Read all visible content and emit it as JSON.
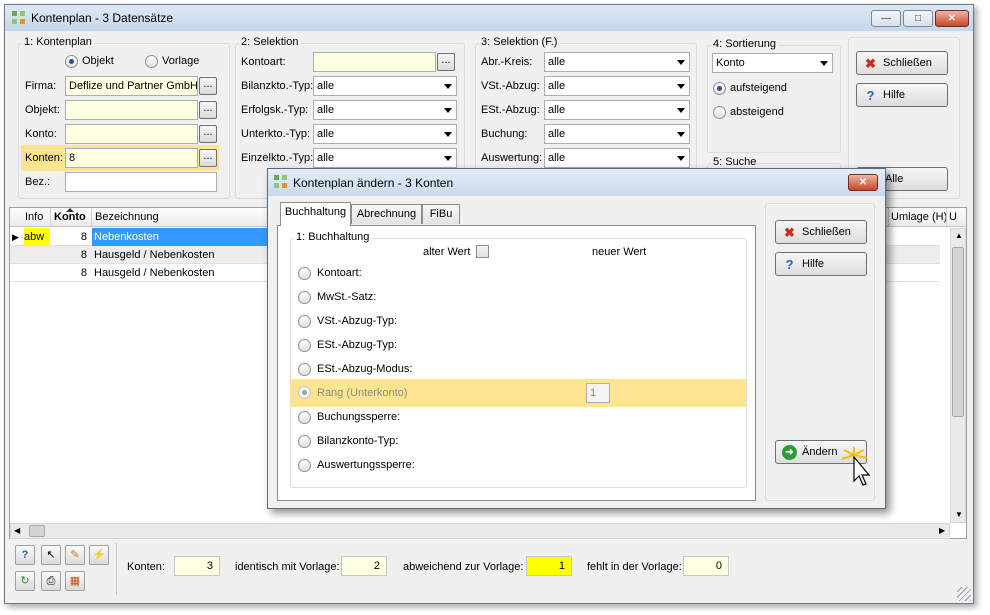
{
  "window": {
    "title": "Kontenplan - 3 Datensätze"
  },
  "group_kontenplan": {
    "label": "1: Kontenplan",
    "radio_objekt": "Objekt",
    "radio_vorlage": "Vorlage",
    "firma_label": "Firma:",
    "firma_value": "Deflize und Partner GmbH",
    "objekt_label": "Objekt:",
    "konto_label": "Konto:",
    "konten_label": "Konten:",
    "konten_value": "8",
    "bez_label": "Bez.:",
    "dots": "..."
  },
  "group_selektion": {
    "label": "2: Selektion",
    "kontoart_label": "Kontoart:",
    "bilanz_label": "Bilanzkto.-Typ:",
    "erfolg_label": "Erfolgsk.-Typ:",
    "unterkto_label": "Unterkto.-Typ:",
    "einzel_label": "Einzelkto.-Typ:",
    "value": "alle"
  },
  "group_selektion_f": {
    "label": "3: Selektion (F.)",
    "abr_label": "Abr.-Kreis:",
    "vst_label": "VSt.-Abzug:",
    "est_label": "ESt.-Abzug:",
    "buchung_label": "Buchung:",
    "auswertung_label": "Auswertung:",
    "value": "alle"
  },
  "group_sortierung": {
    "label": "4: Sortierung",
    "value": "Konto",
    "asc": "aufsteigend",
    "desc": "absteigend"
  },
  "group_suche": {
    "label": "5: Suche"
  },
  "main_buttons": {
    "schliessen": "Schließen",
    "hilfe": "Hilfe",
    "alle": "Alle"
  },
  "grid": {
    "headers": {
      "info": "Info",
      "konto": "Konto",
      "bezeichnung": "Bezeichnung",
      "umlage": "Umlage (H)",
      "u": "U"
    },
    "rows": [
      {
        "info": "abw",
        "konto": "8",
        "bezeichnung": "Nebenkosten"
      },
      {
        "info": "",
        "konto": "8",
        "bezeichnung": "Hausgeld / Nebenkosten"
      },
      {
        "info": "",
        "konto": "8",
        "bezeichnung": "Hausgeld / Nebenkosten"
      }
    ]
  },
  "statusbar": {
    "konten_label": "Konten:",
    "konten_value": "3",
    "identisch_label": "identisch mit Vorlage:",
    "identisch_value": "2",
    "abweichend_label": "abweichend zur Vorlage:",
    "abweichend_value": "1",
    "fehlt_label": "fehlt in der Vorlage:",
    "fehlt_value": "0"
  },
  "dialog": {
    "title": "Kontenplan ändern - 3 Konten",
    "tabs": [
      "Buchhaltung",
      "Abrechnung",
      "FiBu"
    ],
    "section_label": "1: Buchhaltung",
    "alter_wert": "alter Wert",
    "neuer_wert": "neuer Wert",
    "options": [
      "Kontoart:",
      "MwSt.-Satz:",
      "VSt.-Abzug-Typ:",
      "ESt.-Abzug-Typ:",
      "ESt.-Abzug-Modus:",
      "Rang (Unterkonto)",
      "Buchungssperre:",
      "Bilanzkonto-Typ:",
      "Auswertungssperre:"
    ],
    "rang_value": "1",
    "buttons": {
      "schliessen": "Schließen",
      "hilfe": "Hilfe",
      "aendern": "Ändern"
    }
  },
  "colors": {
    "selection": "#3399ff",
    "highlight": "#fde58f",
    "yellow": "#ffff00",
    "info_cell": "#ffff00"
  }
}
